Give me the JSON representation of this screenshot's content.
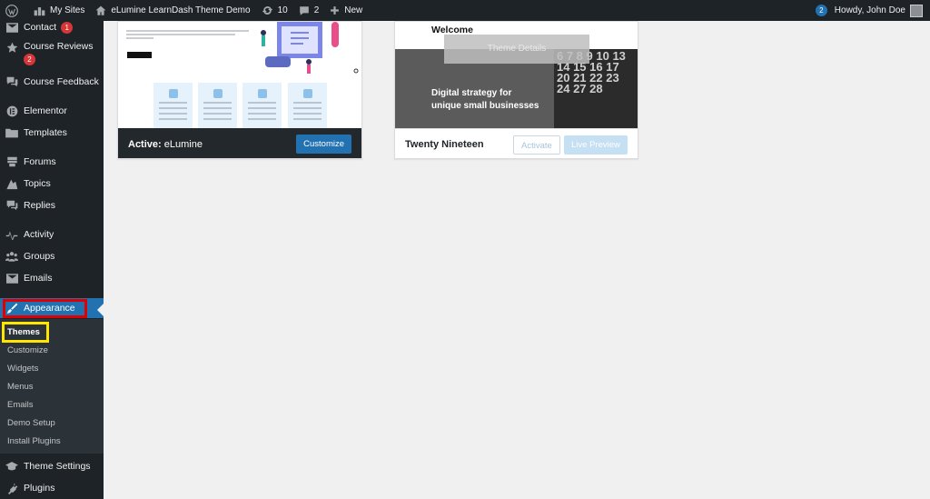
{
  "adminbar": {
    "my_sites": "My Sites",
    "site_name": "eLumine LearnDash Theme Demo",
    "updates_count": "10",
    "comments_count": "2",
    "new_label": "New",
    "notifications_count": "2",
    "howdy": "Howdy, John Doe"
  },
  "sidebar": {
    "contact": {
      "label": "Contact",
      "badge": "1"
    },
    "course_reviews": {
      "label": "Course Reviews",
      "badge": "2"
    },
    "course_feedback": "Course Feedback",
    "elementor": "Elementor",
    "templates": "Templates",
    "forums": "Forums",
    "topics": "Topics",
    "replies": "Replies",
    "activity": "Activity",
    "groups": "Groups",
    "emails": "Emails",
    "appearance": "Appearance",
    "submenu": [
      "Themes",
      "Customize",
      "Widgets",
      "Menus",
      "Emails",
      "Demo Setup",
      "Install Plugins"
    ],
    "theme_settings": "Theme Settings",
    "plugins": "Plugins"
  },
  "themes": {
    "active": {
      "prefix": "Active:",
      "name": "eLumine",
      "customize_label": "Customize"
    },
    "twenty_nineteen": {
      "name": "Twenty Nineteen",
      "activate_label": "Activate",
      "live_preview_label": "Live Preview",
      "details_label": "Theme Details",
      "preview_welcome": "Welcome",
      "preview_headline_1": "Digital strategy for",
      "preview_headline_2": "unique small businesses",
      "preview_calendar": "6 7 8 9 10 13 14 15 16 17 20 21 22 23 24 27 28"
    }
  },
  "colors": {
    "admin_bg": "#1d2327",
    "accent": "#2271b1",
    "badge": "#d63638",
    "highlight_red": "#e00000",
    "highlight_yellow": "#ffe600"
  }
}
